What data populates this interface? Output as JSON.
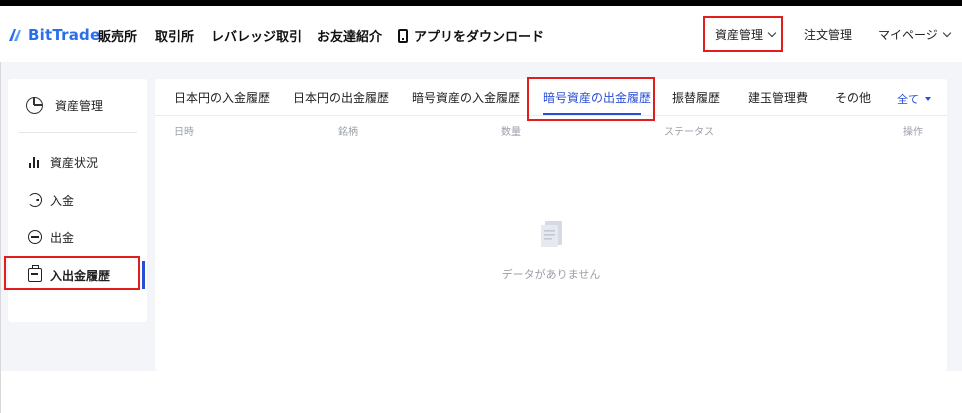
{
  "header": {
    "logo_text": "BitTrade",
    "nav": [
      "販売所",
      "取引所",
      "レバレッジ取引",
      "お友達紹介"
    ],
    "app_download": "アプリをダウンロード",
    "right_nav": {
      "asset_mgmt": "資産管理",
      "order_mgmt": "注文管理",
      "my_page": "マイページ"
    }
  },
  "sidebar": {
    "title": "資産管理",
    "items": [
      {
        "label": "資産状況",
        "icon": "bar-chart-icon"
      },
      {
        "label": "入金",
        "icon": "deposit-icon"
      },
      {
        "label": "出金",
        "icon": "withdraw-icon"
      },
      {
        "label": "入出金履歴",
        "icon": "history-icon",
        "active": true
      }
    ]
  },
  "main": {
    "tabs": [
      {
        "label": "日本円の入金履歴"
      },
      {
        "label": "日本円の出金履歴"
      },
      {
        "label": "暗号資産の入金履歴"
      },
      {
        "label": "暗号資産の出金履歴",
        "active": true
      },
      {
        "label": "振替履歴"
      },
      {
        "label": "建玉管理費"
      },
      {
        "label": "その他"
      }
    ],
    "filter": "全て",
    "columns": [
      "日時",
      "銘柄",
      "数量",
      "ステータス",
      "操作"
    ],
    "empty_text": "データがありません"
  },
  "colors": {
    "brand": "#2a6ee8",
    "accent": "#2a4fd6",
    "highlight": "#e01e1e"
  }
}
